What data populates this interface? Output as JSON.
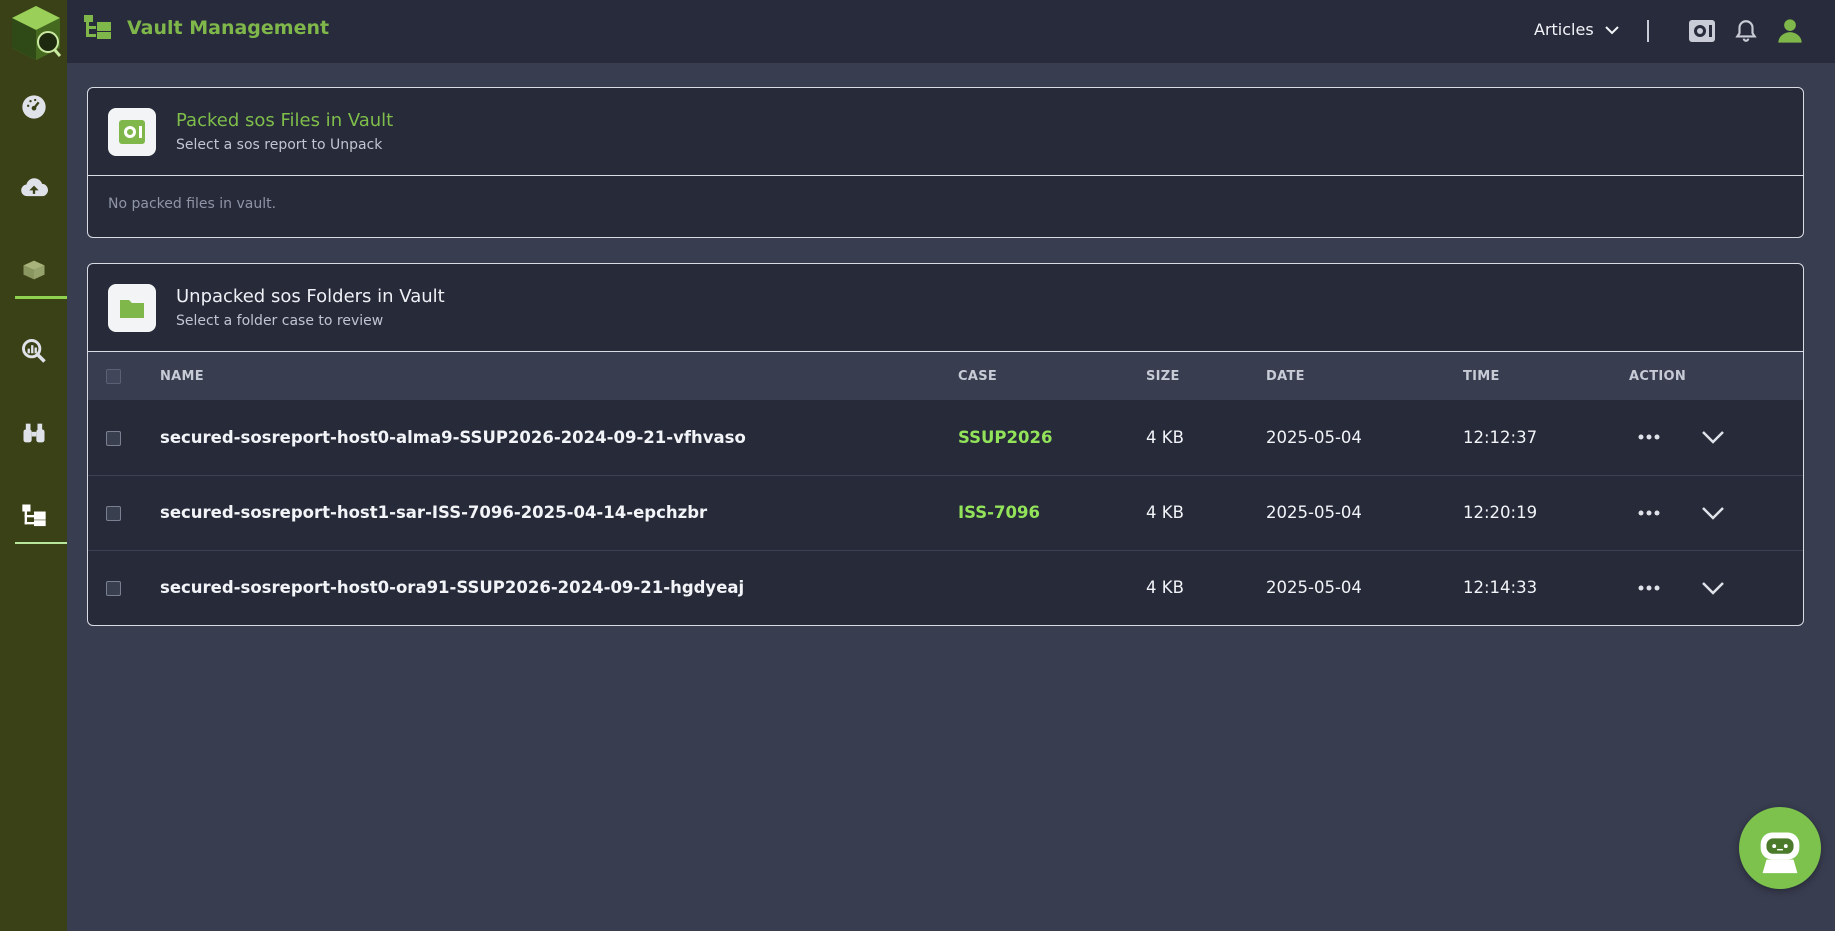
{
  "header": {
    "title": "Vault Management",
    "articles_label": "Articles"
  },
  "sidebar": {
    "items": [
      {
        "icon": "dashboard-icon"
      },
      {
        "icon": "cloud-upload-icon"
      },
      {
        "icon": "package-icon"
      },
      {
        "icon": "analytics-search-icon"
      },
      {
        "icon": "binoculars-icon"
      },
      {
        "icon": "vault-tree-icon"
      }
    ]
  },
  "packed": {
    "title": "Packed sos Files in Vault",
    "subtitle": "Select a sos report to Unpack",
    "empty_text": "No packed files in vault."
  },
  "unpacked": {
    "title": "Unpacked sos Folders in Vault",
    "subtitle": "Select a folder case to review",
    "columns": [
      "NAME",
      "CASE",
      "SIZE",
      "DATE",
      "TIME",
      "ACTION"
    ],
    "rows": [
      {
        "name": "secured-sosreport-host0-alma9-SSUP2026-2024-09-21-vfhvaso",
        "case": "SSUP2026",
        "size": "4 KB",
        "date": "2025-05-04",
        "time": "12:12:37"
      },
      {
        "name": "secured-sosreport-host1-sar-ISS-7096-2025-04-14-epchzbr",
        "case": "ISS-7096",
        "size": "4 KB",
        "date": "2025-05-04",
        "time": "12:20:19"
      },
      {
        "name": "secured-sosreport-host0-ora91-SSUP2026-2024-09-21-hgdyeaj",
        "case": "",
        "size": "4 KB",
        "date": "2025-05-04",
        "time": "12:14:33"
      }
    ]
  },
  "colors": {
    "accent": "#7fb74a",
    "case_link": "#92e35a",
    "sidebar_bg": "#3a4116",
    "header_bg": "#272b3b",
    "page_bg": "#383d50"
  }
}
